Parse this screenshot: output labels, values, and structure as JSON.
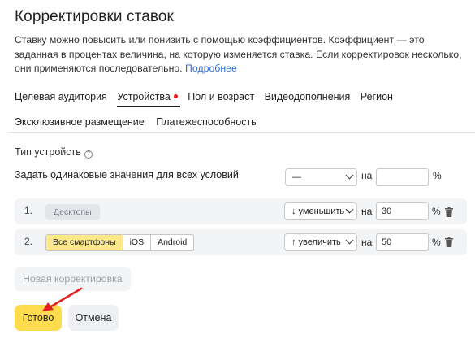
{
  "header": {
    "title": "Корректировки ставок",
    "description": "Ставку можно повысить или понизить с помощью коэффициентов. Коэффициент — это заданная в процентах величина, на которую изменяется ставка. Если корректировок несколько, они применяются последовательно.",
    "more_link": "Подробнее"
  },
  "tabs": [
    {
      "label": "Целевая аудитория",
      "active": false
    },
    {
      "label": "Устройства",
      "active": true,
      "badge": true
    },
    {
      "label": "Пол и возраст",
      "active": false
    },
    {
      "label": "Видеодополнения",
      "active": false
    },
    {
      "label": "Регион",
      "active": false
    },
    {
      "label": "Эксклюзивное размещение",
      "active": false
    },
    {
      "label": "Платежеспособность",
      "active": false
    }
  ],
  "device_type": {
    "label": "Тип устройств",
    "help_icon": "question-icon",
    "same_values_label": "Задать одинаковые значения для всех условий",
    "same_select": "—",
    "na_label": "на",
    "same_value": "",
    "percent": "%"
  },
  "rows": [
    {
      "index": "1.",
      "device_chip": "Десктопы",
      "action": "↓ уменьшить",
      "na_label": "на",
      "value": "30",
      "percent": "%"
    },
    {
      "index": "2.",
      "segments": [
        "Все смартфоны",
        "iOS",
        "Android"
      ],
      "selected_segment": "Все смартфоны",
      "action": "↑ увеличить",
      "na_label": "на",
      "value": "50",
      "percent": "%"
    }
  ],
  "buttons": {
    "new_adjustment": "Новая корректировка",
    "done": "Готово",
    "cancel": "Отмена"
  },
  "colors": {
    "accent_yellow": "#ffdb4d",
    "badge_red": "#e31d1d",
    "link_blue": "#2f6fd6",
    "annotation_arrow": "#e0201e"
  }
}
